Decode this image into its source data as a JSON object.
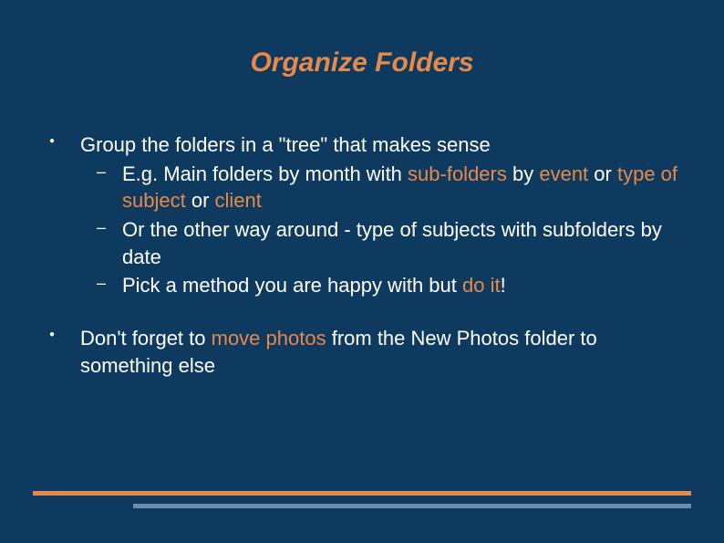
{
  "title": "Organize Folders",
  "bullets": {
    "b1": {
      "text": "Group the folders in a \"tree\" that makes sense",
      "sub": {
        "s1_pre": "E.g. Main folders by month with ",
        "s1_hl1": "sub-folders",
        "s1_mid1": " by ",
        "s1_hl2": "event",
        "s1_mid2": " or ",
        "s1_hl3": "type of subject",
        "s1_mid3": " or ",
        "s1_hl4": "client",
        "s2": "Or the other way around - type of subjects with subfolders by date",
        "s3_pre": "Pick a method you are happy with but ",
        "s3_hl": "do it",
        "s3_post": "!"
      }
    },
    "b2": {
      "pre": "Don't forget to ",
      "hl": "move photos",
      "post": " from the New Photos folder to something else"
    }
  },
  "colors": {
    "background": "#0f3a5f",
    "accent": "#e68a4a",
    "secondary": "#6a8fae",
    "text": "#ffffff"
  }
}
